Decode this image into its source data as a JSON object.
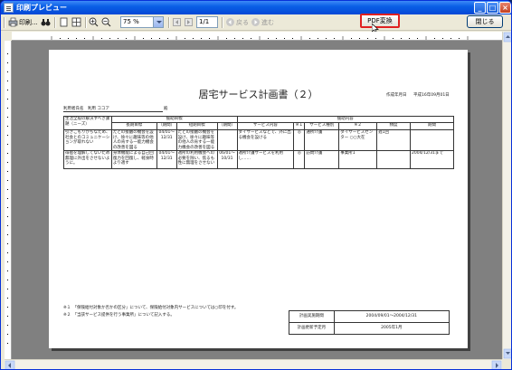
{
  "window": {
    "title": "印刷プレビュー",
    "min": "_",
    "max": "□",
    "close": "×"
  },
  "toolbar": {
    "print_label": "印刷...",
    "zoom_value": "75 %",
    "page_value": "1/1",
    "back_label": "戻る",
    "forward_label": "進む",
    "pdf_label": "PDF変換",
    "close_label": "閉じる"
  },
  "doc": {
    "title": "居宅サービス計画書（２）",
    "created_label": "作成年月日",
    "created_value": "平成16年09月01日",
    "user_label": "利用者氏名",
    "user_value": "利用 ココア",
    "user_suffix": "殿",
    "headers": {
      "needs": "生活全般の解決すべき課題（ニーズ）",
      "goals": "援助目標",
      "long_goal": "長期目標",
      "long_period": "（期間）",
      "short_goal": "短期目標",
      "short_period": "（期間）",
      "content": "援助内容",
      "service_content": "サービス内容",
      "mark1": "※１",
      "service_type": "サービス種別",
      "mark2": "※２",
      "frequency": "頻度",
      "period": "期間"
    },
    "rows": [
      {
        "needs": "引きこもりがちなため、社会とのコミュニケーションが取れない",
        "long_goal": "たとの接触の機会を設け、徐々に趣味等の他人の肯する一能力機会の改善を図る",
        "long_period": "04/01～ 12/31",
        "short_goal": "たとの接触の機会を設け、徐々に趣味等の他人の肯する一能力機会の改善を図る",
        "short_period": "",
        "service_content": "ダイサービスなどで、外に出る機会を設ける",
        "mark1": "◎",
        "service_type": "通所介護",
        "mark2": "ダイサービスセンター ○○大在",
        "frequency": "週1回",
        "period": ""
      },
      {
        "needs": "徘徊を理解してないため無理に外出をさせないように。",
        "long_goal": "身体機能による自己回復力を回復し、軽食時より適す",
        "long_period": "04/01～ 12/31",
        "short_goal": "適所の利用機会への必要を除い、焦るも性に無理をさせない",
        "short_period": "06/01～ 10/31",
        "service_content": "適所介護サービスを利用し……",
        "mark1": "◎",
        "service_type": "訪問介護",
        "mark2": "事業所1",
        "frequency": "",
        "period": "2004/12/31まで"
      }
    ],
    "note1": "※１　「保険給付対象か否かの区分」について、保険給付対象内サービスについては○印を付す。",
    "note2": "※２　「当該サービス提供を行う事業所」について記入する。",
    "plan_period_label": "計画実施期間",
    "plan_period_value": "2004/09/01～2004/12/31",
    "plan_update_label": "計画更新予定月",
    "plan_update_value": "2005年1月"
  }
}
